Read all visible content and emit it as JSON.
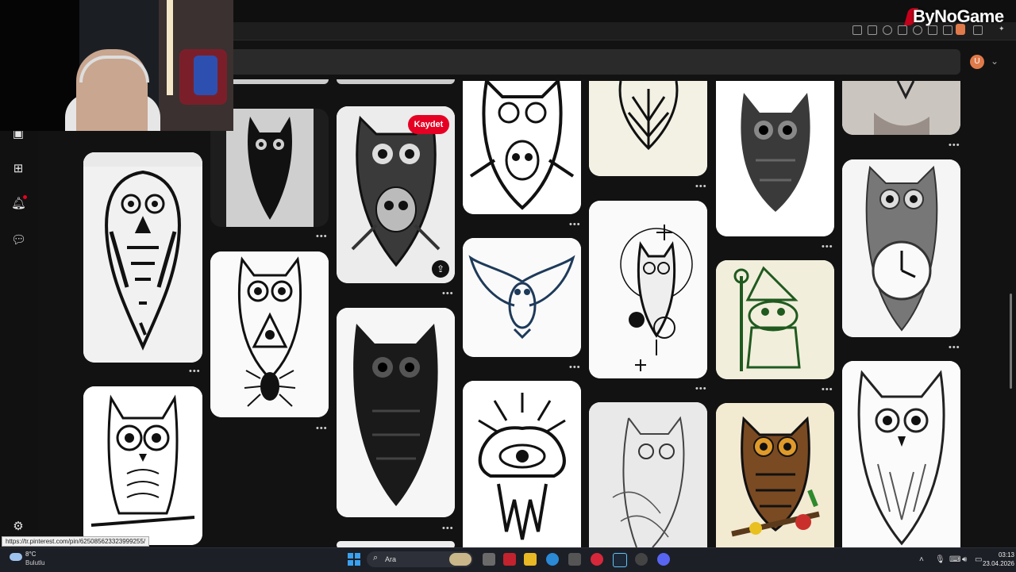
{
  "browser": {
    "avatar_initial": "U",
    "status_url": "https://tr.pinterest.com/pin/625085623323999255/"
  },
  "watermark": {
    "text": "ByNoGame"
  },
  "rail": {
    "icons": [
      "boards-icon",
      "create-icon",
      "notifications-icon",
      "messages-icon",
      "settings-icon"
    ]
  },
  "pins": {
    "save_label": "Kaydet",
    "more_label": "•••",
    "items": [
      {
        "name": "polynesian-owl-pin",
        "style": "tribal"
      },
      {
        "name": "lineart-owl-pin",
        "style": "cartoon"
      },
      {
        "name": "tribal-owl-arm-pin",
        "style": "blackwork"
      },
      {
        "name": "owl-spider-pin",
        "style": "geometric"
      },
      {
        "name": "skull-owl-pin",
        "style": "skull"
      },
      {
        "name": "black-owl-pin",
        "style": "dark"
      },
      {
        "name": "traditional-owl-pin",
        "style": "traditional"
      },
      {
        "name": "flying-owl-pin",
        "style": "flying"
      },
      {
        "name": "eye-pyramid-pin",
        "style": "eye"
      },
      {
        "name": "geometric-heart-pin",
        "style": "leaf"
      },
      {
        "name": "moon-owl-flowers-pin",
        "style": "floral"
      },
      {
        "name": "sketch-owl-pin",
        "style": "sketch"
      },
      {
        "name": "realistic-owl-pin",
        "style": "realistic"
      },
      {
        "name": "frog-wizard-pin",
        "style": "frog"
      },
      {
        "name": "color-owl-branch-pin",
        "style": "color"
      },
      {
        "name": "wrist-tattoo-pin",
        "style": "photo"
      },
      {
        "name": "clock-owl-pin",
        "style": "clock"
      },
      {
        "name": "horned-owl-pin",
        "style": "horned"
      }
    ]
  },
  "taskbar": {
    "weather_temp": "8°C",
    "weather_cond": "Bulutlu",
    "search_placeholder": "Ara",
    "time": "03:13",
    "date": "23.04.2026"
  },
  "colors": {
    "accent": "#e60023",
    "background": "#121212",
    "taskbar": "#1c1f26"
  }
}
